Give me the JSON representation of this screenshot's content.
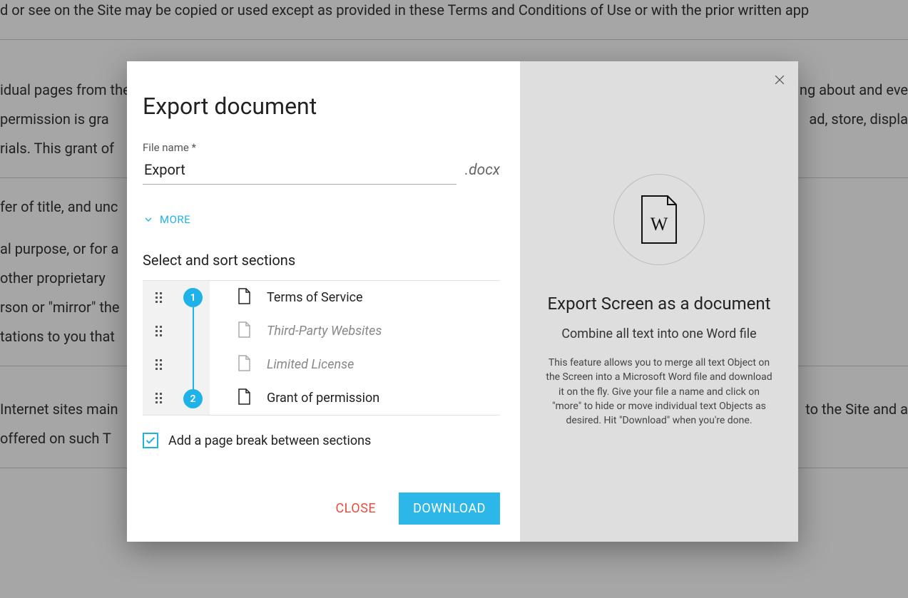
{
  "background": {
    "line1": "d or see on the Site may be copied or used except as provided in these Terms and Conditions of Use or with the prior written app",
    "line2a": "idual pages from the",
    "line2b": "ng about and eve",
    "line3a": " permission is gra",
    "line3b": "ad, store, displa",
    "line4": "rials. This grant of",
    "line5": "fer of title, and unc",
    "line6": "al purpose, or for a",
    "line7": " other proprietary ",
    "line8": "rson or \"mirror\" the",
    "line9": "tations to you that",
    "line10a": "Internet sites main",
    "line10b": "to the Site and a",
    "line11": " offered on such T"
  },
  "modal": {
    "title": "Export document",
    "file_name_label": "File name *",
    "file_name_value": "Export",
    "file_ext": ".docx",
    "more_label": "MORE",
    "sections_heading": "Select and sort sections",
    "steps": {
      "first": "1",
      "second": "2"
    },
    "sections": [
      {
        "label": "Terms of Service",
        "faded": false
      },
      {
        "label": "Third-Party Websites",
        "faded": true
      },
      {
        "label": "Limited License",
        "faded": true
      },
      {
        "label": "Grant of permission",
        "faded": false
      }
    ],
    "checkbox_label": "Add a page break between sections",
    "close_label": "CLOSE",
    "download_label": "DOWNLOAD"
  },
  "right_panel": {
    "title": "Export Screen as a document",
    "subtitle": "Combine all text into one Word file",
    "description": "This feature allows you to merge all text Object on the Screen into a Microsoft Word file and download it on the fly. Give your file a name and click on \"more\" to hide or move individual text Objects as desired. Hit \"Download\" when you're done."
  }
}
